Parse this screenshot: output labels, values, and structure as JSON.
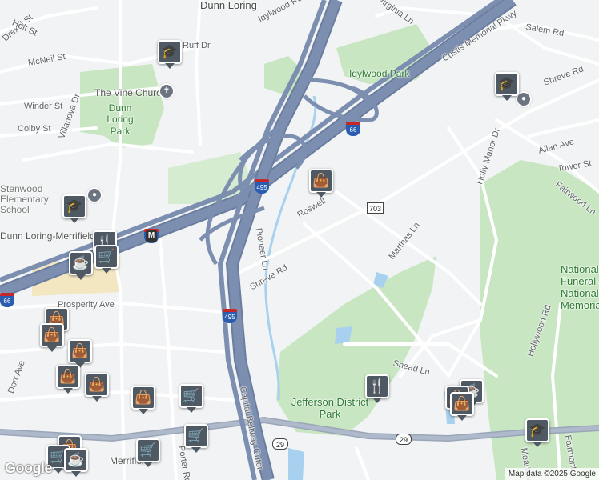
{
  "map": {
    "roads": [
      "Dunn Loring",
      "Idylwood Rd",
      "Virginia Ln",
      "Custis Memorial Pkwy",
      "Salem Rd",
      "Shreve Rd",
      "Drexel St",
      "Holt St",
      "McNeil St",
      "Ruff Dr",
      "Winder St",
      "Villanova Dr",
      "Colby St",
      "Allan Ave",
      "Tower St",
      "Fairwood Ln",
      "Holly Manor Dr",
      "Roswell",
      "Marthas Ln",
      "Pioneer Ln",
      "Shreve Rd",
      "Prosperity Ave",
      "Dorr Ave",
      "Snead Ln",
      "Hollywood Rd",
      "Capital Beltway Outer",
      "Porter Rd",
      "Fairmont",
      "Meadow",
      "Dunn Loring-Merrifield",
      "Merrifield"
    ],
    "places": {
      "vine_church": "The Vine Church",
      "dunn_loring_park": "Dunn Loring Park",
      "idylwood_park": "Idylwood Park",
      "jefferson_park": "Jefferson District Park",
      "stenwood": "Stenwood Elementary School",
      "national_funeral": "National Funeral & National Memorial",
      "dunn_loring_metro": "Dunn Loring-Merrifield",
      "merrifield": "Merrifield"
    },
    "shields": [
      "66",
      "495",
      "66",
      "703",
      "495",
      "66",
      "29",
      "29"
    ],
    "google": "Google",
    "attribution": "Map data ©2025 Google",
    "colors": {
      "highway": "#7c8fb0",
      "highway_edge": "#6a7d9f",
      "park": "#c8e6c1",
      "water": "#a8d1f0",
      "road": "#ffffff",
      "pin": "#4f5963"
    },
    "pins": [
      "school-icon",
      "school-icon",
      "school-icon",
      "school-icon",
      "shopping-bag-icon",
      "coffee-icon",
      "shopping-cart-icon",
      "restaurant-icon"
    ]
  }
}
